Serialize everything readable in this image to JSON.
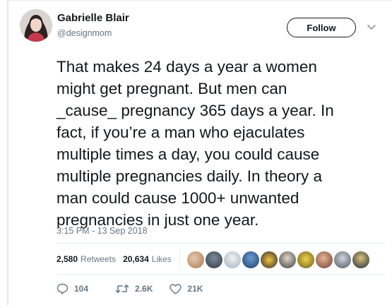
{
  "author": {
    "display_name": "Gabrielle Blair",
    "handle": "@designmom"
  },
  "follow_label": "Follow",
  "tweet": {
    "text": "That makes 24 days a year a women\nmight get pregnant. But men can\n_cause_ pregnancy 365 days a year. In\nfact, if you’re a man who ejaculates\nmultiple times a day, you could cause\nmultiple pregnancies daily. In theory a\nman could cause 1000+ unwanted\npregnancies in just one year.",
    "timestamp": "3:15 PM - 13 Sep 2018"
  },
  "stats": {
    "retweets_count": "2,580",
    "retweets_label": "Retweets",
    "likes_count": "20,634",
    "likes_label": "Likes"
  },
  "actions": {
    "reply_count": "104",
    "retweet_count": "2.6K",
    "like_count": "21K"
  },
  "colors": {
    "text": "#14171a",
    "secondary": "#657786",
    "border": "#e6ecf0"
  },
  "icons": [
    "chevron-down-icon",
    "reply-icon",
    "retweet-icon",
    "heart-icon"
  ]
}
